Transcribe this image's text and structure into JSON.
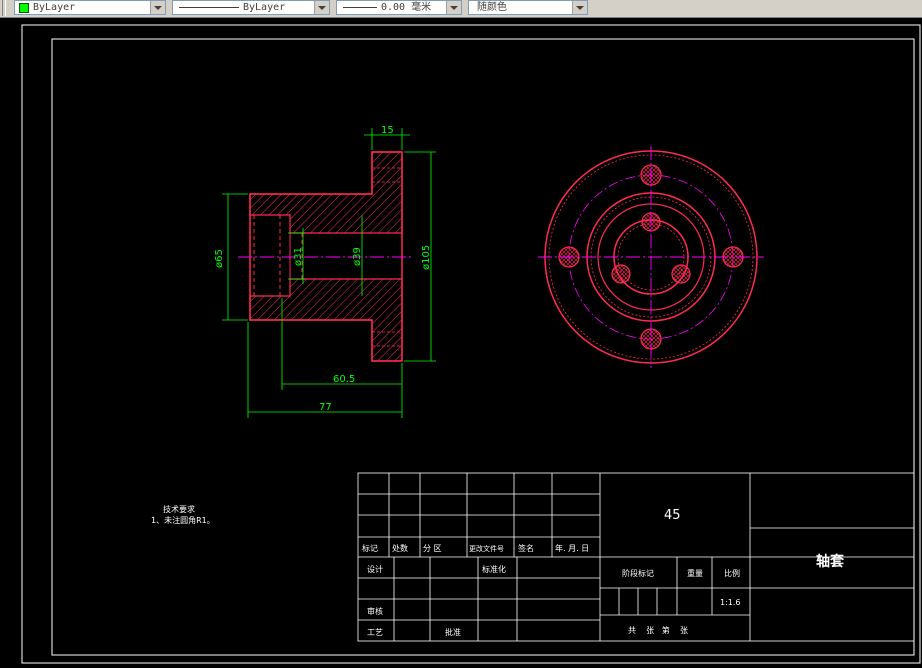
{
  "toolbar": {
    "color_control": "ByLayer",
    "linetype_control": "ByLayer",
    "lineweight_control": "0.00 毫米",
    "plotstyle_control": "随颜色"
  },
  "dimensions": {
    "flange_width": "15",
    "dia_65": "ø65",
    "dia_31": "ø31",
    "dia_39": "ø39",
    "dia_105": "ø105",
    "length_60_5": "60.5",
    "length_77": "77"
  },
  "notes": {
    "title": "技术要求",
    "line1": "1、未注圆角R1。"
  },
  "title_block": {
    "material": "45",
    "part_name": "轴套",
    "scale": "1:1.6",
    "rev_mark": "标记",
    "rev_count": "处数",
    "rev_zone": "分 区",
    "rev_doc": "更改文件号",
    "rev_sign": "签名",
    "rev_date": "年. 月. 日",
    "design": "设计",
    "standardize": "标准化",
    "stage_mark": "阶段标记",
    "weight": "重量",
    "scale_label": "比例",
    "review": "审核",
    "process": "工艺",
    "approve": "批准",
    "sheets": "共    张   第    张"
  },
  "colors": {
    "outline": "#ff2a55",
    "hatch": "#ff2a55",
    "dimension": "#00ff00",
    "centerline": "#ff00ff",
    "frame": "#ffffff",
    "background": "#000000"
  }
}
